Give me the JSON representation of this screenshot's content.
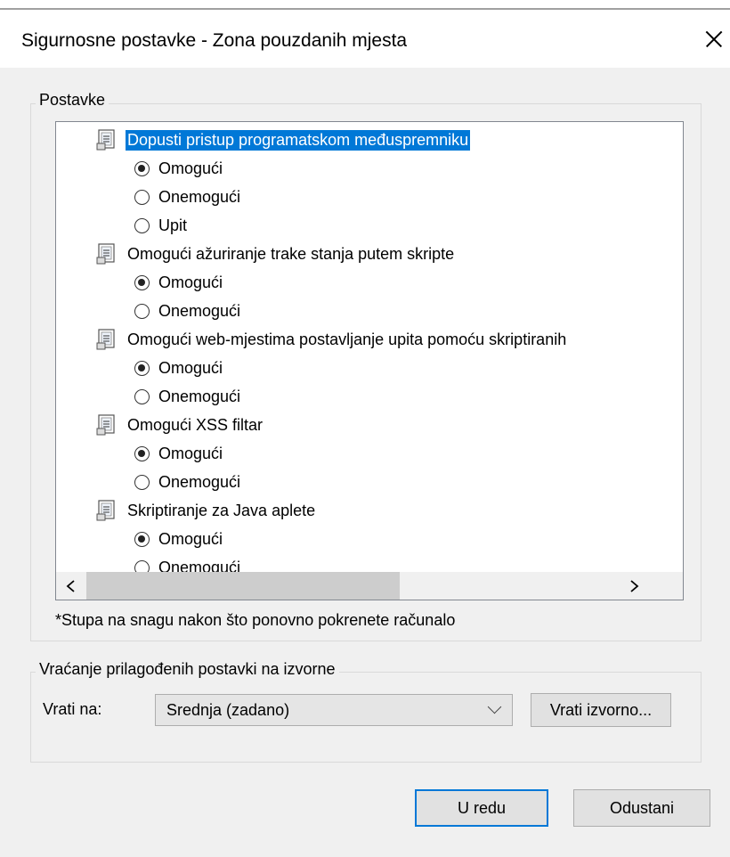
{
  "window": {
    "title": "Sigurnosne postavke - Zona pouzdanih mjesta",
    "close_icon": "close-icon"
  },
  "settings_group": {
    "legend": "Postavke"
  },
  "list": {
    "items": [
      {
        "type": "header",
        "label": "Dopusti pristup programatskom međuspremniku",
        "selected": true
      },
      {
        "type": "option",
        "label": "Omogući",
        "checked": true
      },
      {
        "type": "option",
        "label": "Onemogući",
        "checked": false
      },
      {
        "type": "option",
        "label": "Upit",
        "checked": false
      },
      {
        "type": "header",
        "label": "Omogući ažuriranje trake stanja putem skripte",
        "selected": false
      },
      {
        "type": "option",
        "label": "Omogući",
        "checked": true
      },
      {
        "type": "option",
        "label": "Onemogući",
        "checked": false
      },
      {
        "type": "header",
        "label": "Omogući web-mjestima postavljanje upita pomoću skriptiranih",
        "selected": false
      },
      {
        "type": "option",
        "label": "Omogući",
        "checked": true
      },
      {
        "type": "option",
        "label": "Onemogući",
        "checked": false
      },
      {
        "type": "header",
        "label": "Omogući XSS filtar",
        "selected": false
      },
      {
        "type": "option",
        "label": "Omogući",
        "checked": true
      },
      {
        "type": "option",
        "label": "Onemogući",
        "checked": false
      },
      {
        "type": "header",
        "label": "Skriptiranje za Java aplete",
        "selected": false
      },
      {
        "type": "option",
        "label": "Omogući",
        "checked": true
      },
      {
        "type": "option",
        "label": "Onemogući",
        "checked": false
      }
    ],
    "scroll_up": "^",
    "scroll_down": "v",
    "scroll_left": "<",
    "scroll_right": ">"
  },
  "note": "*Stupa na snagu nakon što ponovno pokrenete računalo",
  "reset_group": {
    "legend": "Vraćanje prilagođenih postavki na izvorne",
    "reset_to_label": "Vrati na:",
    "selected_level": "Srednja (zadano)",
    "reset_button": "Vrati izvorno..."
  },
  "buttons": {
    "ok": "U redu",
    "cancel": "Odustani"
  },
  "colors": {
    "selection": "#0078d7",
    "background": "#f0f0f0"
  }
}
